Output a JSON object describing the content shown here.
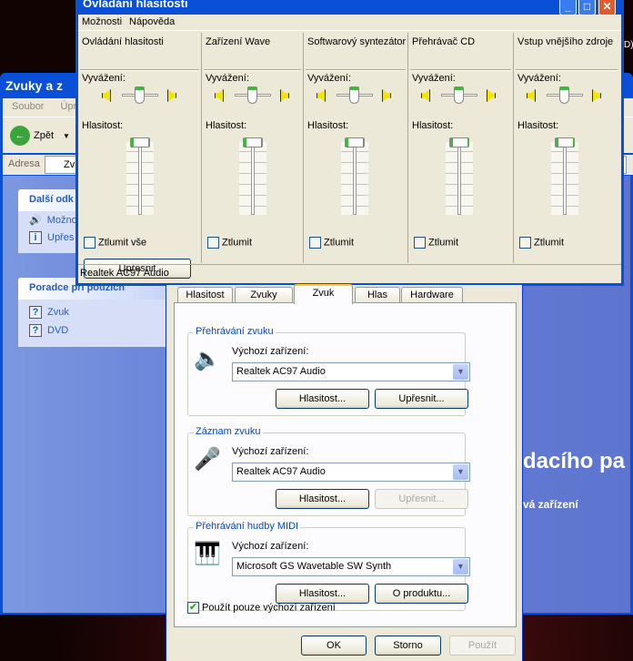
{
  "control_panel": {
    "title": "Zvuky a z",
    "menu": [
      "Soubor",
      "Úpr"
    ],
    "back_label": "Zpět",
    "address_label": "Adresa",
    "address_value": "Zv",
    "panel1": {
      "title": "Další odk",
      "items": [
        "Možno",
        "Upřes"
      ]
    },
    "panel2": {
      "title": "Poradce při potížích",
      "items": [
        "Zvuk",
        "DVD"
      ]
    },
    "heading_fragment": "dacího pa",
    "subtext_fragment": "vá zařízení",
    "edge_fragment": "D)"
  },
  "volume_window": {
    "title": "Ovládání hlasitosti",
    "menu": [
      "Možnosti",
      "Nápověda"
    ],
    "balance_label": "Vyvážení:",
    "volume_label": "Hlasitost:",
    "columns": [
      {
        "name": "Ovládání hlasitosti",
        "mute": "Ztlumit vše"
      },
      {
        "name": "Zařízení Wave",
        "mute": "Ztlumit"
      },
      {
        "name": "Softwarový syntezátor",
        "mute": "Ztlumit"
      },
      {
        "name": "Přehrávač CD",
        "mute": "Ztlumit"
      },
      {
        "name": "Vstup vnějšího zdroje",
        "mute": "Ztlumit"
      }
    ],
    "advanced_button": "Upřesnit",
    "status": "Realtek AC97 Audio"
  },
  "sound_dialog": {
    "tabs": [
      "Hlasitost",
      "Zvuky",
      "Zvuk",
      "Hlas",
      "Hardware"
    ],
    "active_tab": "Zvuk",
    "default_device_label": "Výchozí zařízení:",
    "groups": [
      {
        "title": "Přehrávání zvuku",
        "device": "Realtek AC97 Audio",
        "btn1": "Hlasitost...",
        "btn2": "Upřesnit..."
      },
      {
        "title": "Záznam zvuku",
        "device": "Realtek AC97 Audio",
        "btn1": "Hlasitost...",
        "btn2": "Upřesnit..."
      },
      {
        "title": "Přehrávání hudby MIDI",
        "device": "Microsoft GS Wavetable SW Synth",
        "btn1": "Hlasitost...",
        "btn2": "O produktu..."
      }
    ],
    "use_default_only": "Použít pouze výchozí zařízení",
    "use_default_checked": true,
    "ok": "OK",
    "cancel": "Storno",
    "apply": "Použít"
  }
}
